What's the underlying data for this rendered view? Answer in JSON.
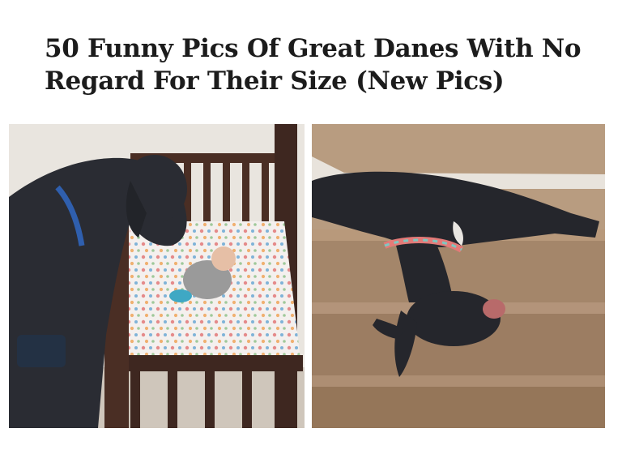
{
  "article": {
    "title_line1": "50 Funny Pics Of Great Danes With No",
    "title_line2": "Regard For Their Size (New Pics)"
  },
  "photos": [
    {
      "subject": "great-dane-looking-into-crib-at-baby"
    },
    {
      "subject": "great-dane-lying-upside-down-on-stairs"
    }
  ],
  "colors": {
    "text": "#1c1c1c",
    "dog": "#2a2c33",
    "crib_wood": "#4a2e24",
    "carpet": "#a4866a",
    "wall_right": "#b89c80"
  }
}
